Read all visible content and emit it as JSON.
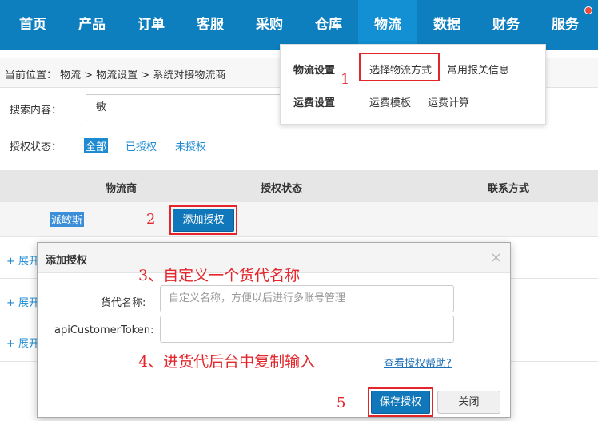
{
  "nav": {
    "items": [
      "首页",
      "产品",
      "订单",
      "客服",
      "采购",
      "仓库",
      "物流",
      "数据",
      "财务",
      "服务"
    ],
    "active_index": 6
  },
  "breadcrumb": {
    "prefix": "当前位置：",
    "path": "物流 > 物流设置 > 系统对接物流商"
  },
  "search": {
    "label": "搜索内容：",
    "value": "敏"
  },
  "auth_filter": {
    "label": "授权状态：",
    "options": [
      "全部",
      "已授权",
      "未授权"
    ],
    "selected": "全部"
  },
  "table": {
    "headers": [
      "物流商",
      "授权状态",
      "联系方式"
    ],
    "rows": [
      {
        "carrier": "派敏斯",
        "action": "添加授权"
      }
    ],
    "expand_label": "+ 展开"
  },
  "dropdown": {
    "groups": [
      {
        "title": "物流设置",
        "items": [
          "选择物流方式",
          "常用报关信息"
        ]
      },
      {
        "title": "运费设置",
        "items": [
          "运费模板",
          "运费计算"
        ]
      }
    ]
  },
  "modal": {
    "title": "添加授权",
    "close_glyph": "×",
    "fields": [
      {
        "label": "货代名称:",
        "placeholder": "自定义名称，方便以后进行多账号管理"
      },
      {
        "label": "apiCustomerToken:",
        "placeholder": ""
      }
    ],
    "help_link": "查看授权帮助?",
    "save_label": "保存授权",
    "close_label": "关闭"
  },
  "annotations": {
    "steps": [
      "1",
      "2",
      "5"
    ],
    "note3": "3、自定义一个货代名称",
    "note4": "4、进货代后台中复制输入"
  },
  "colors": {
    "nav_bg": "#0d7fbf",
    "accent": "#1177bb",
    "annotation_red": "#e3262b"
  }
}
